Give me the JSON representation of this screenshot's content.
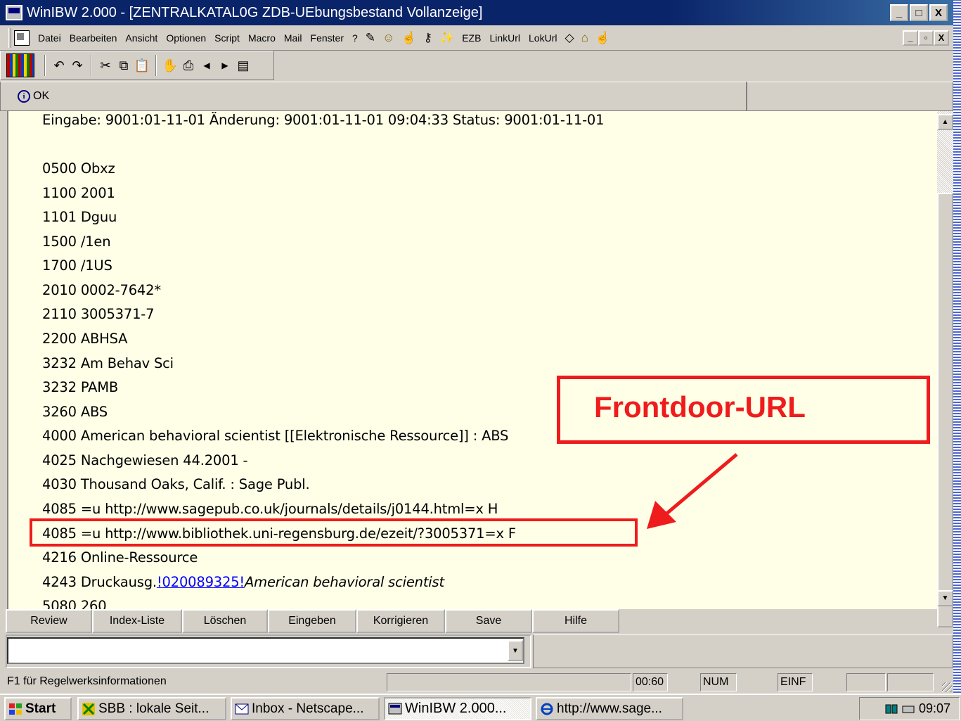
{
  "window": {
    "title": "WinIBW 2.000 - [ZENTRALKATAL0G ZDB-UEbungsbestand Vollanzeige]",
    "caption_buttons": [
      "_",
      "□",
      "X"
    ]
  },
  "menu": {
    "items": [
      "Datei",
      "Bearbeiten",
      "Ansicht",
      "Optionen",
      "Script",
      "Macro",
      "Mail",
      "Fenster",
      "?"
    ],
    "extra_items": [
      "EZB",
      "LinkUrl",
      "LokUrl"
    ],
    "mdi_buttons": [
      "_",
      "▫",
      "X"
    ]
  },
  "toolbar": {
    "icons": [
      "library-icon",
      "undo-icon",
      "redo-icon",
      "cut-icon",
      "copy-icon",
      "paste-icon",
      "stop-icon",
      "print-icon",
      "prev-icon",
      "next-icon",
      "view-icon"
    ]
  },
  "status_message": "OK",
  "document": {
    "lines": [
      "Eingabe: 9001:01-11-01 Änderung: 9001:01-11-01 09:04:33 Status: 9001:01-11-01",
      "",
      "0500 Obxz",
      "1100 2001",
      "1101 Dguu",
      "1500 /1en",
      "1700 /1US",
      "2010 0002-7642*",
      "2110 3005371-7",
      "2200 ABHSA",
      "3232 Am Behav Sci",
      "3232 PAMB",
      "3260 ABS",
      "4000 American behavioral scientist [[Elektronische Ressource]] : ABS",
      "4025 Nachgewiesen 44.2001 -",
      "4030 Thousand Oaks, Calif. : Sage Publ.",
      "4085 =u http://www.sagepub.co.uk/journals/details/j0144.html=x H",
      "4085 =u http://www.bibliothek.uni-regensburg.de/ezeit/?3005371=x F",
      "4216 Online-Ressource"
    ],
    "line_4243": {
      "prefix": "4243 Druckausg.",
      "link": "!020089325!",
      "italic": "American behavioral scientist"
    },
    "partial_line": "5080 260"
  },
  "annotation": {
    "label": "Frontdoor-URL",
    "color": "#ee1c1c"
  },
  "buttons": [
    "Review",
    "Index-Liste",
    "Löschen",
    "Eingeben",
    "Korrigieren",
    "Save",
    "Hilfe"
  ],
  "command_input": {
    "value": ""
  },
  "statusbar": {
    "hint": "F1 für Regelwerksinformationen",
    "time_cell": "00:60",
    "num": "NUM",
    "insert": "EINF"
  },
  "taskbar": {
    "start": "Start",
    "tasks": [
      "SBB : lokale Seit...",
      "Inbox - Netscape...",
      "WinIBW 2.000...",
      "http://www.sage..."
    ],
    "clock": "09:07"
  },
  "colors": {
    "titlebar": "#0a246a",
    "document_bg": "#ffffe8",
    "chrome": "#d4d0c8",
    "link": "#0000ff",
    "annotation": "#ee1c1c"
  }
}
